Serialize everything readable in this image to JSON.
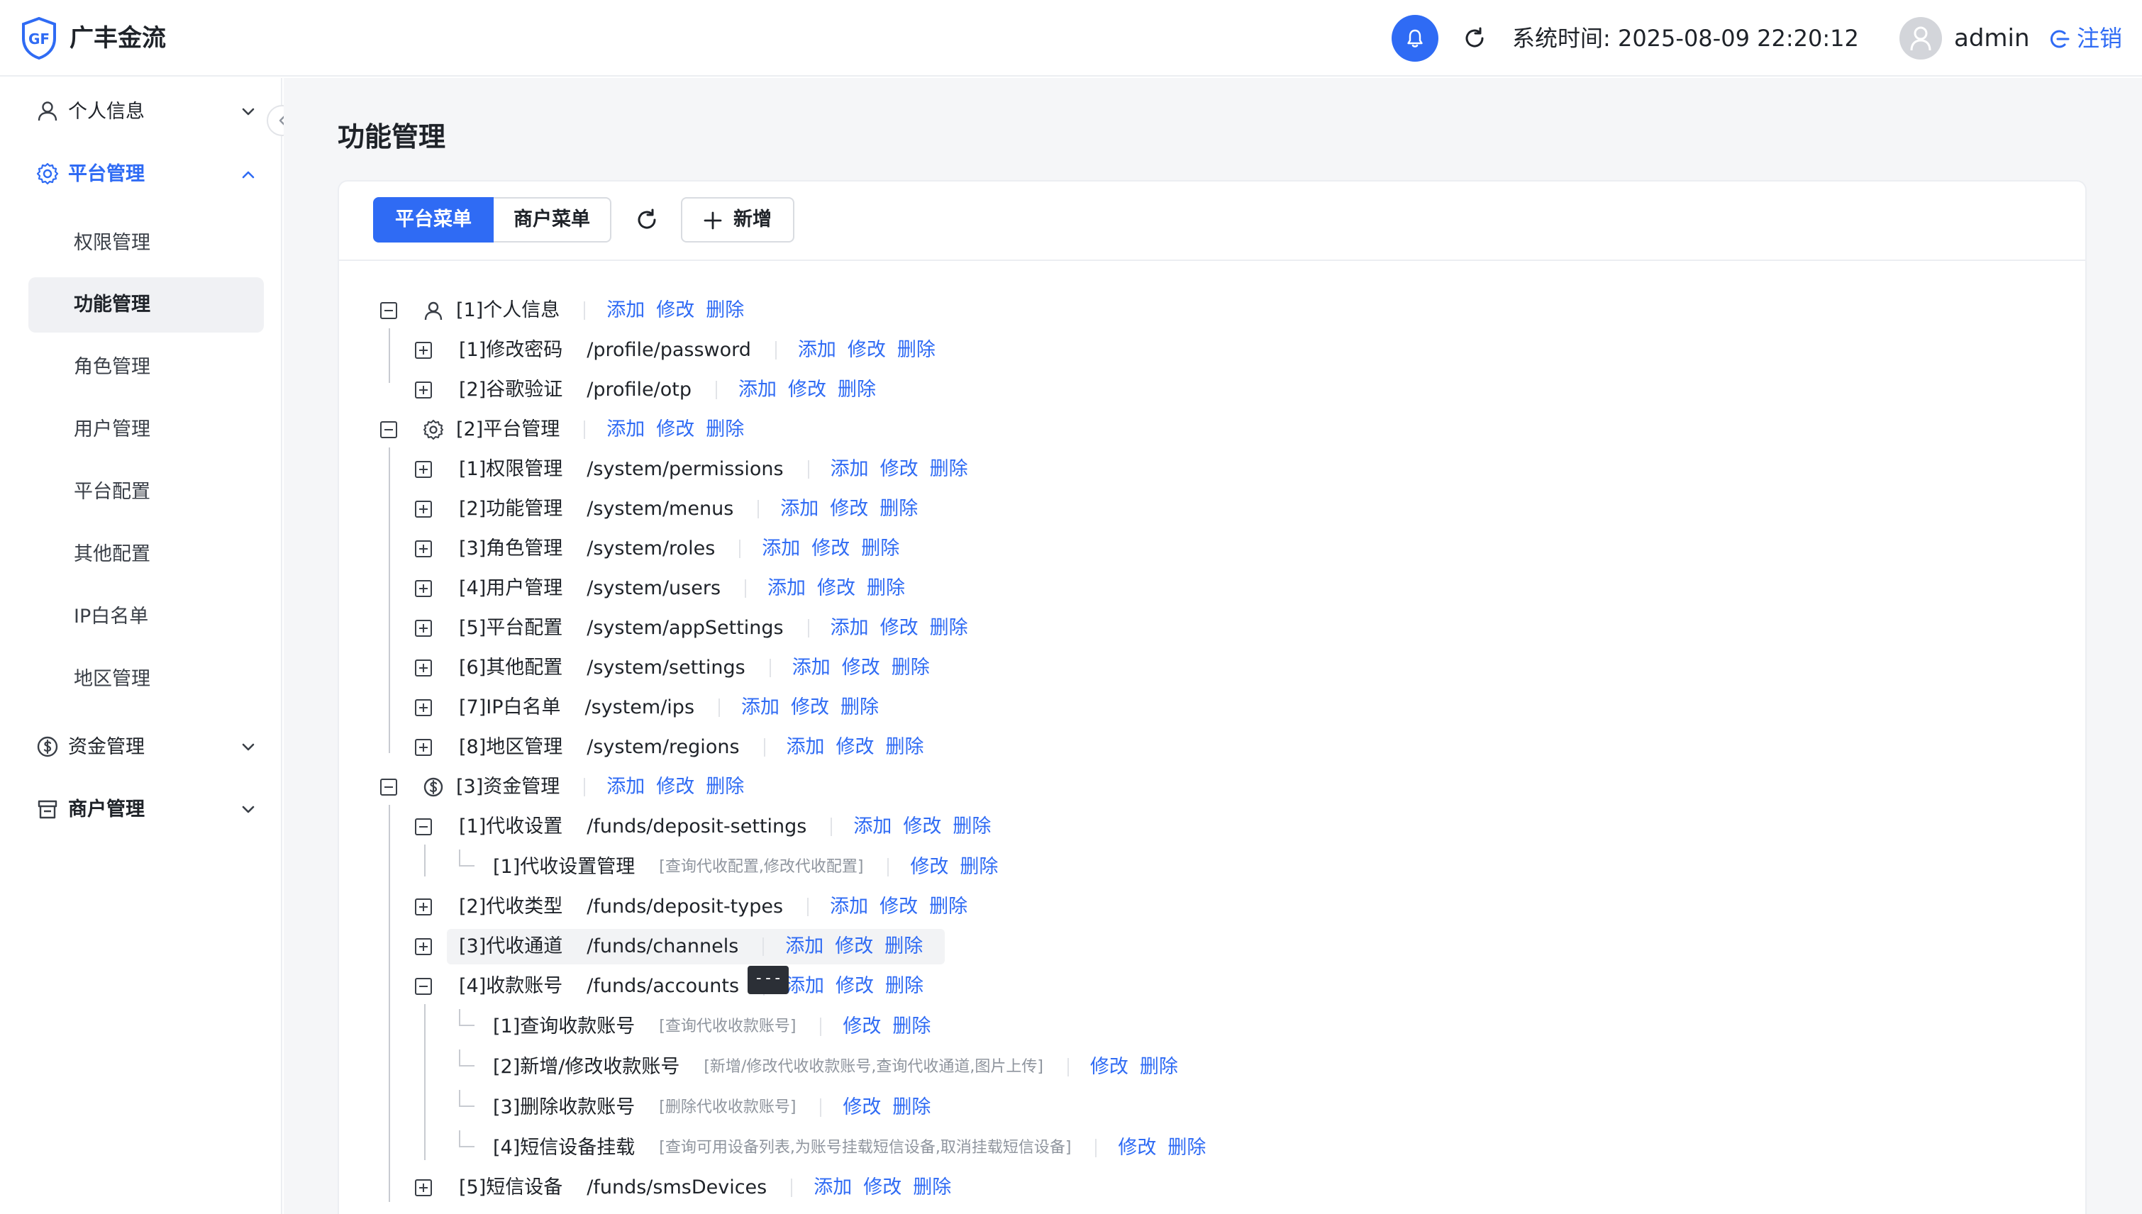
{
  "header": {
    "logo_text": "GF",
    "brand": "广丰金流",
    "system_time": "系统时间: 2025-08-09 22:20:12",
    "username": "admin",
    "logout_label": "注销",
    "accent_color": "#2f6bf4"
  },
  "sidebar": {
    "groups": [
      {
        "label": "个人信息",
        "icon": "user-icon",
        "expanded": false
      },
      {
        "label": "平台管理",
        "icon": "gear-icon",
        "expanded": true,
        "active": true
      },
      {
        "label": "资金管理",
        "icon": "dollar-circle-icon",
        "expanded": false
      },
      {
        "label": "商户管理",
        "icon": "store-icon",
        "expanded": false
      }
    ],
    "platform_items": [
      "权限管理",
      "功能管理",
      "角色管理",
      "用户管理",
      "平台配置",
      "其他配置",
      "IP白名单",
      "地区管理"
    ],
    "selected_item": "功能管理"
  },
  "main": {
    "page_title": "功能管理",
    "tabs": [
      "平台菜单",
      "商户菜单"
    ],
    "active_tab": "平台菜单",
    "add_label": "新增",
    "actions": {
      "add": "添加",
      "edit": "修改",
      "delete": "删除"
    },
    "tooltip": "---",
    "tree": [
      {
        "name": "[1]个人信息",
        "level": 0,
        "icon": "user-icon",
        "expanded": true
      },
      {
        "name": "[1]修改密码",
        "path": "/profile/password",
        "level": 1
      },
      {
        "name": "[2]谷歌验证",
        "path": "/profile/otp",
        "level": 1
      },
      {
        "name": "[2]平台管理",
        "level": 0,
        "icon": "gear-icon",
        "expanded": true
      },
      {
        "name": "[1]权限管理",
        "path": "/system/permissions",
        "level": 1
      },
      {
        "name": "[2]功能管理",
        "path": "/system/menus",
        "level": 1
      },
      {
        "name": "[3]角色管理",
        "path": "/system/roles",
        "level": 1
      },
      {
        "name": "[4]用户管理",
        "path": "/system/users",
        "level": 1
      },
      {
        "name": "[5]平台配置",
        "path": "/system/appSettings",
        "level": 1
      },
      {
        "name": "[6]其他配置",
        "path": "/system/settings",
        "level": 1
      },
      {
        "name": "[7]IP白名单",
        "path": "/system/ips",
        "level": 1
      },
      {
        "name": "[8]地区管理",
        "path": "/system/regions",
        "level": 1
      },
      {
        "name": "[3]资金管理",
        "level": 0,
        "icon": "dollar-circle-icon",
        "expanded": true
      },
      {
        "name": "[1]代收设置",
        "path": "/funds/deposit-settings",
        "level": 1,
        "expanded": true
      },
      {
        "name": "[1]代收设置管理",
        "desc": "[查询代收配置,修改代收配置]",
        "level": 2
      },
      {
        "name": "[2]代收类型",
        "path": "/funds/deposit-types",
        "level": 1
      },
      {
        "name": "[3]代收通道",
        "path": "/funds/channels",
        "level": 1,
        "hovered": true
      },
      {
        "name": "[4]收款账号",
        "path": "/funds/accounts",
        "level": 1,
        "expanded": true
      },
      {
        "name": "[1]查询收款账号",
        "desc": "[查询代收收款账号]",
        "level": 2
      },
      {
        "name": "[2]新增/修改收款账号",
        "desc": "[新增/修改代收收款账号,查询代收通道,图片上传]",
        "level": 2
      },
      {
        "name": "[3]删除收款账号",
        "desc": "[删除代收收款账号]",
        "level": 2
      },
      {
        "name": "[4]短信设备挂载",
        "desc": "[查询可用设备列表,为账号挂载短信设备,取消挂载短信设备]",
        "level": 2
      },
      {
        "name": "[5]短信设备",
        "path": "/funds/smsDevices",
        "level": 1
      }
    ]
  }
}
